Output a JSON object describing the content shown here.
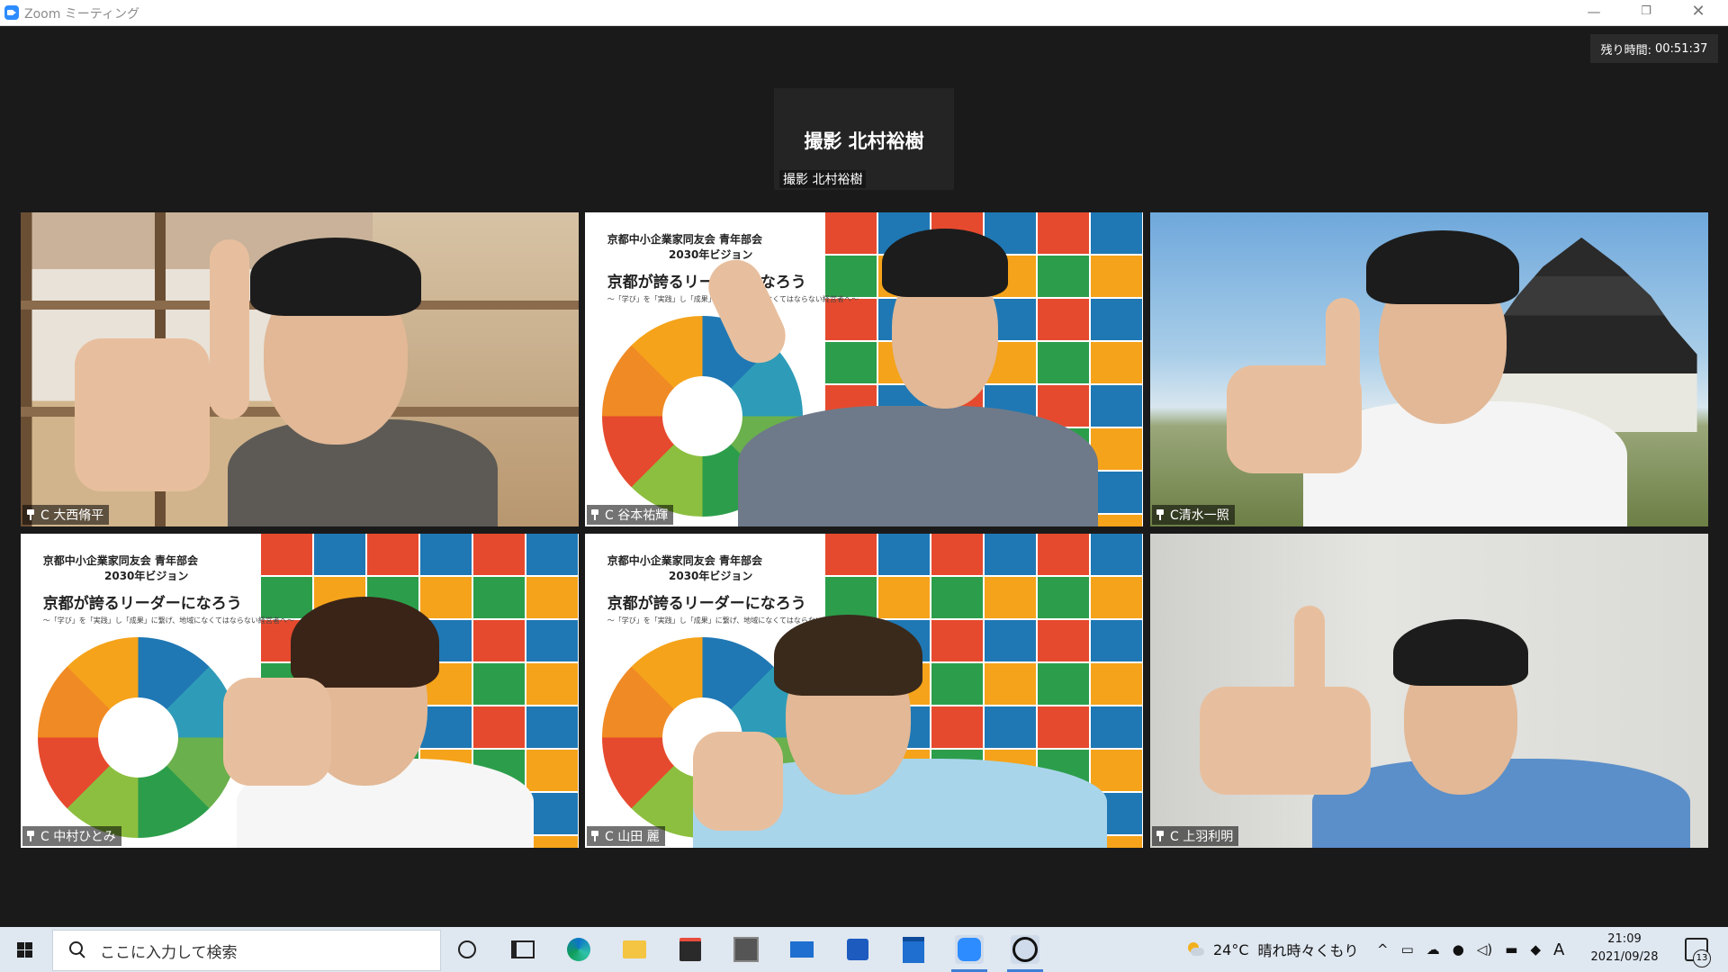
{
  "window": {
    "title": "Zoom ミーティング",
    "min_glyph": "—",
    "max_glyph": "❐",
    "close_glyph": "✕"
  },
  "timer": {
    "label": "残り時間:",
    "value": "00:51:37"
  },
  "top_card": {
    "display_name": "撮影 北村裕樹",
    "name_tag": "撮影 北村裕樹"
  },
  "tiles": [
    {
      "name": "C 大西脩平"
    },
    {
      "name": "C 谷本祐輝"
    },
    {
      "name": "C清水一照"
    },
    {
      "name": "C 中村ひとみ"
    },
    {
      "name": "C 山田 麗"
    },
    {
      "name": "C 上羽利明"
    }
  ],
  "slide": {
    "org": "京都中小企業家同友会  青年部会",
    "vision": "2030年ビジョン",
    "headline": "京都が誇るリーダーになろう",
    "subtitle": "〜「学び」を「実践」し「成果」に繋げ、地域になくてはならない経営者へ〜"
  },
  "taskbar": {
    "search_placeholder": "ここに入力して検索",
    "apps": [
      "cortana-icon",
      "task-view-icon",
      "edge-icon",
      "file-explorer-icon",
      "store-icon",
      "photo-app-icon",
      "mail-icon",
      "app-icon",
      "calendar-app-icon",
      "zoom-icon",
      "chat-app-icon"
    ],
    "weather_temp": "24°C",
    "weather_text": "晴れ時々くもり",
    "ime_indicator": "A",
    "time": "21:09",
    "date": "2021/09/28",
    "notification_count": "13"
  },
  "colors": {
    "accent": "#2d8cff",
    "taskbar_bg": "#dfe7f0",
    "meeting_bg": "#1a1a1a"
  }
}
